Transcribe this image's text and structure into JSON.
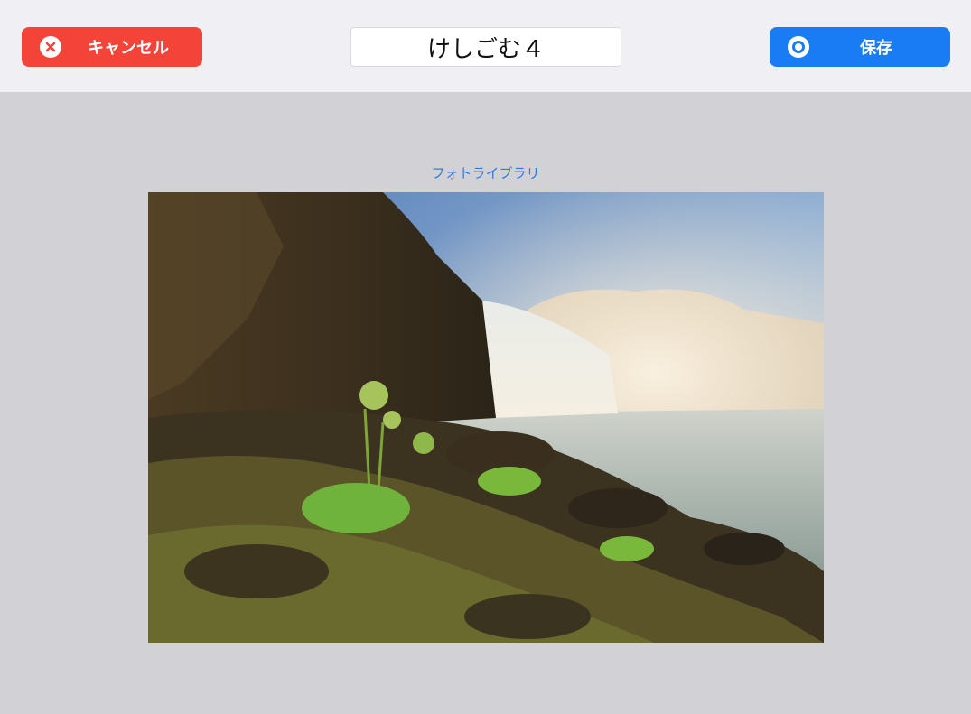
{
  "toolbar": {
    "cancel_label": "キャンセル",
    "cancel_icon": "close-circle-icon",
    "title_value": "けしごむ４",
    "save_label": "保存",
    "save_icon": "radio-circle-icon",
    "cancel_color": "#f4443a",
    "save_color": "#1a7cf5"
  },
  "main": {
    "library_link": "フォトライブラリ",
    "photo_description_icon": "waterfall-photo"
  }
}
